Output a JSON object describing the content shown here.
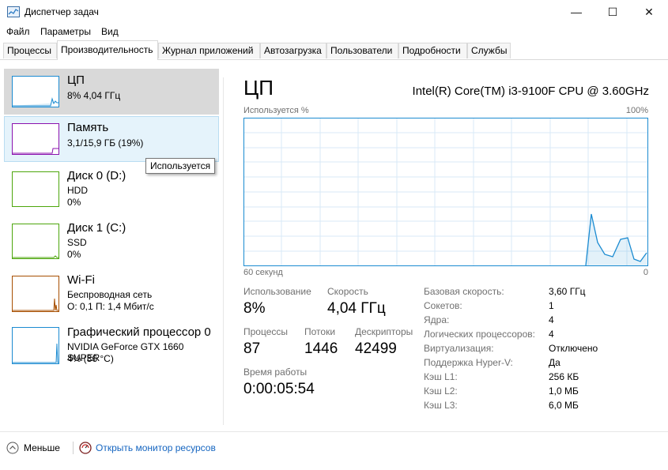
{
  "window": {
    "title": "Диспетчер задач",
    "controls": {
      "minimize": "—",
      "maximize": "☐",
      "close": "✕"
    }
  },
  "menu": [
    "Файл",
    "Параметры",
    "Вид"
  ],
  "tabs": [
    "Процессы",
    "Производительность",
    "Журнал приложений",
    "Автозагрузка",
    "Пользователи",
    "Подробности",
    "Службы"
  ],
  "sidebar": {
    "cpu": {
      "name": "ЦП",
      "line1": "8%  4,04 ГГц",
      "color": "#1b8bd1"
    },
    "memory": {
      "name": "Память",
      "line1": "3,1/15,9 ГБ (19%)",
      "color": "#8b12ae"
    },
    "disk0": {
      "name": "Диск 0 (D:)",
      "line1": "HDD",
      "line2": "0%",
      "color": "#4da60c"
    },
    "disk1": {
      "name": "Диск 1 (C:)",
      "line1": "SSD",
      "line2": "0%",
      "color": "#4da60c"
    },
    "wifi": {
      "name": "Wi-Fi",
      "line1": "Беспроводная сеть",
      "line2": "О: 0,1  П: 1,4 Мбит/с",
      "color": "#a74f01"
    },
    "gpu": {
      "name": "Графический процессор 0",
      "line1": "NVIDIA GeForce GTX 1660 SUPER",
      "line2": "4% (36 °C)",
      "color": "#1b8bd1"
    }
  },
  "tooltip": "Используется",
  "main": {
    "title": "ЦП",
    "cpu_model": "Intel(R) Core(TM) i3-9100F CPU @ 3.60GHz",
    "graph_label_left": "Используется %",
    "graph_label_right": "100%",
    "graph_bottom_left": "60 секунд",
    "graph_bottom_right": "0",
    "stats": {
      "usage_label": "Использование",
      "usage_value": "8%",
      "speed_label": "Скорость",
      "speed_value": "4,04 ГГц",
      "processes_label": "Процессы",
      "processes_value": "87",
      "threads_label": "Потоки",
      "threads_value": "1446",
      "handles_label": "Дескрипторы",
      "handles_value": "42499",
      "uptime_label": "Время работы",
      "uptime_value": "0:00:05:54"
    },
    "specs": [
      {
        "label": "Базовая скорость:",
        "value": "3,60 ГГц"
      },
      {
        "label": "Сокетов:",
        "value": "1"
      },
      {
        "label": "Ядра:",
        "value": "4"
      },
      {
        "label": "Логических процессоров:",
        "value": "4"
      },
      {
        "label": "Виртуализация:",
        "value": "Отключено"
      },
      {
        "label": "Поддержка Hyper-V:",
        "value": "Да"
      },
      {
        "label": "Кэш L1:",
        "value": "256 КБ"
      },
      {
        "label": "Кэш L2:",
        "value": "1,0 МБ"
      },
      {
        "label": "Кэш L3:",
        "value": "6,0 МБ"
      }
    ]
  },
  "bottom": {
    "fewer_label": "Меньше",
    "resmon_label": "Открыть монитор ресурсов"
  }
}
